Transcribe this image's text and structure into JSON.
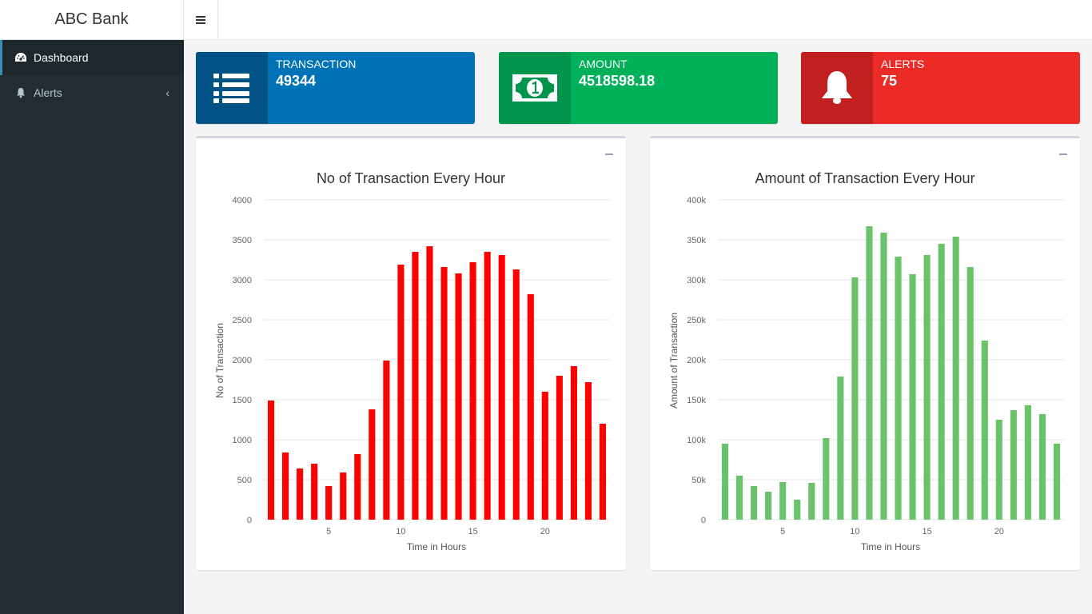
{
  "app": {
    "brand": "ABC Bank"
  },
  "sidebar": {
    "items": [
      {
        "label": "Dashboard",
        "icon": "dashboard-icon",
        "active": true
      },
      {
        "label": "Alerts",
        "icon": "bell-icon",
        "active": false
      }
    ]
  },
  "info_boxes": [
    {
      "label": "TRANSACTION",
      "value": "49344",
      "icon": "list-icon",
      "color": "#0073b7",
      "icon_bg": "#005384"
    },
    {
      "label": "AMOUNT",
      "value": "4518598.18",
      "icon": "money-icon",
      "color": "#00a65a",
      "icon_bg": "#008d4c"
    },
    {
      "label": "ALERTS",
      "value": "75",
      "icon": "bell-icon",
      "color": "#dd4b39",
      "icon_bg": "#d33724"
    }
  ],
  "chart_data": [
    {
      "type": "bar",
      "title": "No of Transaction Every Hour",
      "xlabel": "Time in Hours",
      "ylabel": "No of Transaction",
      "x": [
        1,
        2,
        3,
        4,
        5,
        6,
        7,
        8,
        9,
        10,
        11,
        12,
        13,
        14,
        15,
        16,
        17,
        18,
        19,
        20,
        21,
        22,
        23,
        24
      ],
      "values": [
        1490,
        840,
        640,
        700,
        420,
        590,
        820,
        1380,
        1990,
        3190,
        3350,
        3420,
        3160,
        3080,
        3220,
        3350,
        3310,
        3130,
        2820,
        1600,
        1800,
        1920,
        1720,
        1200
      ],
      "ylim": [
        0,
        4000
      ],
      "yticks": [
        "0",
        "500",
        "1000",
        "1500",
        "2000",
        "2500",
        "3000",
        "3500",
        "4000"
      ],
      "xticks": [
        "5",
        "10",
        "15",
        "20"
      ],
      "color": "#ff0000",
      "grid": true
    },
    {
      "type": "bar",
      "title": "Amount of Transaction Every Hour",
      "xlabel": "Time in Hours",
      "ylabel": "Amount of Transaction",
      "x": [
        1,
        2,
        3,
        4,
        5,
        6,
        7,
        8,
        9,
        10,
        11,
        12,
        13,
        14,
        15,
        16,
        17,
        18,
        19,
        20,
        21,
        22,
        23,
        24
      ],
      "values": [
        95000,
        55000,
        42000,
        35000,
        47000,
        25000,
        46000,
        102000,
        179000,
        303000,
        367000,
        359000,
        329000,
        307000,
        331000,
        345000,
        354000,
        316000,
        224000,
        125000,
        137000,
        143000,
        132000,
        95000
      ],
      "ylim": [
        0,
        400000
      ],
      "yticks": [
        "0",
        "50k",
        "100k",
        "150k",
        "200k",
        "250k",
        "300k",
        "350k",
        "400k"
      ],
      "xticks": [
        "5",
        "10",
        "15",
        "20"
      ],
      "color": "#6ac26a",
      "grid": true
    }
  ]
}
